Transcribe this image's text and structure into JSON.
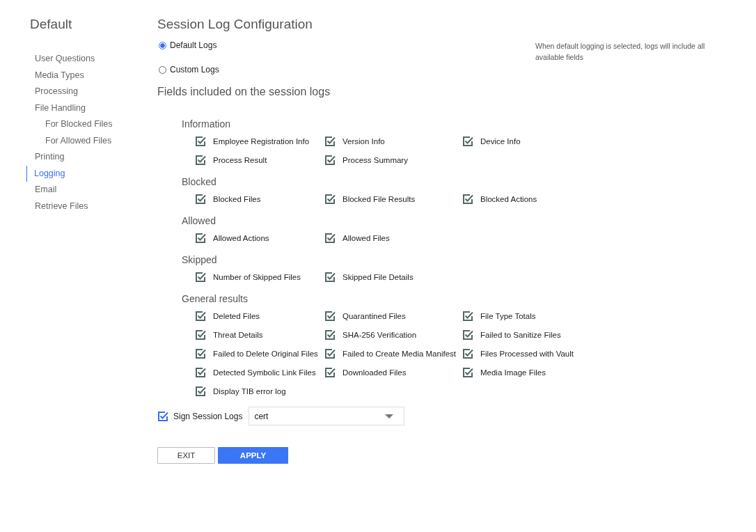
{
  "sidebar": {
    "title": "Default",
    "items": [
      {
        "label": "User Questions",
        "selected": false
      },
      {
        "label": "Media Types",
        "selected": false
      },
      {
        "label": "Processing",
        "selected": false
      },
      {
        "label": "File Handling",
        "selected": false,
        "children": [
          {
            "label": "For Blocked Files",
            "selected": false
          },
          {
            "label": "For Allowed Files",
            "selected": false
          }
        ]
      },
      {
        "label": "Printing",
        "selected": false
      },
      {
        "label": "Logging",
        "selected": true
      },
      {
        "label": "Email",
        "selected": false
      },
      {
        "label": "Retrieve Files",
        "selected": false
      }
    ]
  },
  "title": "Session Log Configuration",
  "modes": [
    {
      "label": "Default Logs",
      "selected": true
    },
    {
      "label": "Custom Logs",
      "selected": false
    }
  ],
  "note": "When default logging is selected, logs will include all available fields",
  "fields_heading": "Fields included on the session logs",
  "groups": [
    {
      "name": "Information",
      "disabled": true,
      "fields": [
        {
          "label": "Employee Registration Info",
          "checked": true
        },
        {
          "label": "Version Info",
          "checked": true
        },
        {
          "label": "Device Info",
          "checked": true
        },
        {
          "label": "Process Result",
          "checked": true
        },
        {
          "label": "Process Summary",
          "checked": true
        }
      ]
    },
    {
      "name": "Blocked",
      "disabled": true,
      "fields": [
        {
          "label": "Blocked Files",
          "checked": true
        },
        {
          "label": "Blocked File Results",
          "checked": true
        },
        {
          "label": "Blocked Actions",
          "checked": true
        }
      ]
    },
    {
      "name": "Allowed",
      "disabled": true,
      "fields": [
        {
          "label": "Allowed Actions",
          "checked": true
        },
        {
          "label": "Allowed Files",
          "checked": true
        }
      ]
    },
    {
      "name": "Skipped",
      "disabled": true,
      "fields": [
        {
          "label": "Number of Skipped Files",
          "checked": true
        },
        {
          "label": "Skipped File Details",
          "checked": true
        }
      ]
    },
    {
      "name": "General results",
      "disabled": true,
      "fields": [
        {
          "label": "Deleted Files",
          "checked": true
        },
        {
          "label": "Quarantined Files",
          "checked": true
        },
        {
          "label": "File Type Totals",
          "checked": true
        },
        {
          "label": "Threat Details",
          "checked": true
        },
        {
          "label": "SHA-256 Verification",
          "checked": true
        },
        {
          "label": "Failed to Sanitize Files",
          "checked": true
        },
        {
          "label": "Failed to Delete Original Files",
          "checked": true
        },
        {
          "label": "Failed to Create Media Manifest",
          "checked": true
        },
        {
          "label": "Files Processed with Vault",
          "checked": true
        },
        {
          "label": "Detected Symbolic Link Files",
          "checked": true
        },
        {
          "label": "Downloaded Files",
          "checked": true
        },
        {
          "label": "Media Image Files",
          "checked": true
        },
        {
          "label": "Display TIB error log",
          "checked": true
        }
      ]
    }
  ],
  "sign": {
    "label": "Sign Session Logs",
    "checked": true,
    "disabled": false,
    "value": "cert"
  },
  "buttons": [
    {
      "label": "EXIT",
      "kind": "secondary"
    },
    {
      "label": "APPLY",
      "kind": "primary"
    }
  ]
}
